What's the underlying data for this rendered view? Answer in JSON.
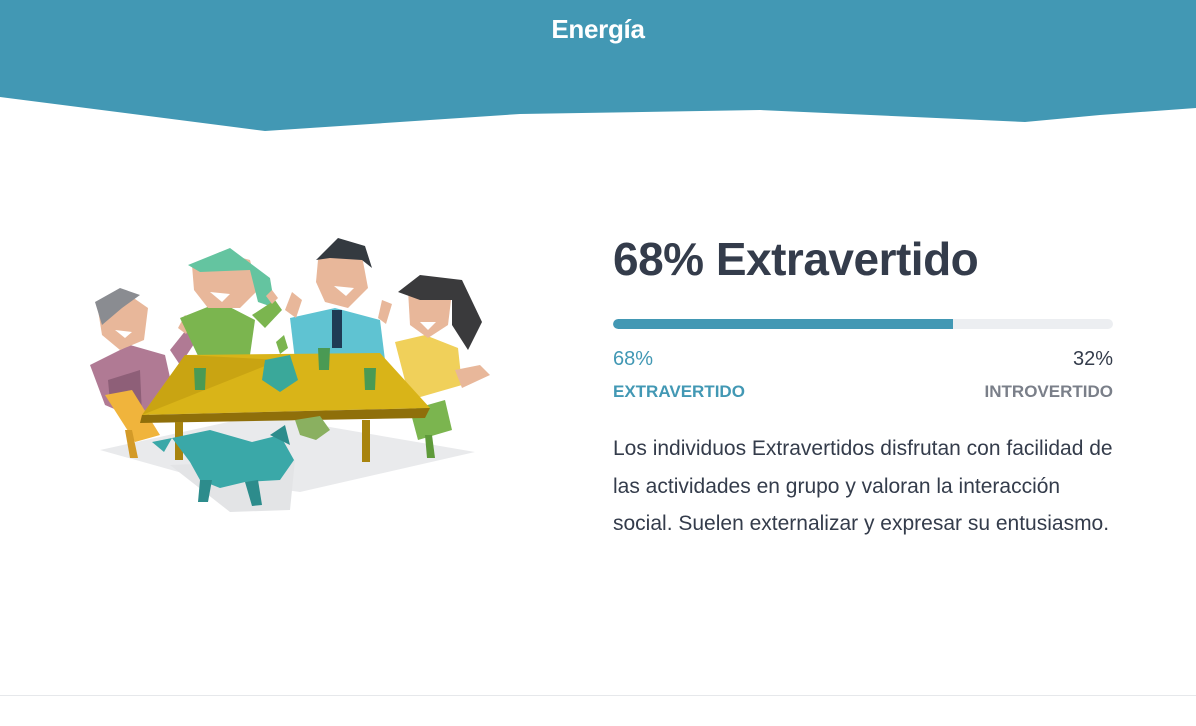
{
  "header": {
    "title": "Energía",
    "background_color": "#4298b4"
  },
  "result": {
    "headline": "68% Extravertido",
    "primary_percent": "68%",
    "primary_label": "EXTRAVERTIDO",
    "secondary_percent": "32%",
    "secondary_label": "INTROVERTIDO",
    "fill_fraction": 0.68,
    "accent_color": "#4298b4",
    "description": "Los individuos Extravertidos disfrutan con facilidad de las actividades en grupo y valoran la interacción social. Suelen externalizar y expresar su entusiasmo."
  },
  "illustration": {
    "icon": "group-at-table-illustration"
  }
}
